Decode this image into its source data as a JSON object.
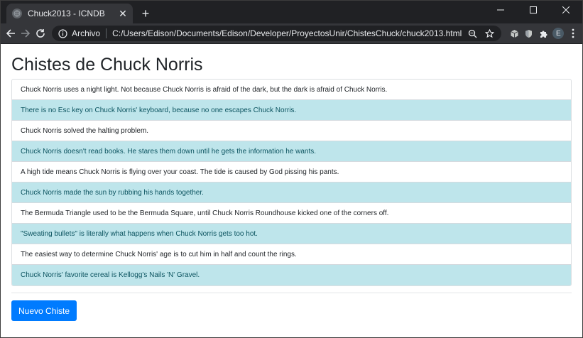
{
  "browser": {
    "tab_title": "Chuck2013 - ICNDB",
    "tab_close": "✕",
    "new_tab": "+",
    "scheme_label": "Archivo",
    "url": "C:/Users/Edison/Documents/Edison/Developer/ProyectosUnir/ChistesChuck/chuck2013.html",
    "profile_initial": "E"
  },
  "page": {
    "title": "Chistes de Chuck Norris",
    "jokes": [
      "Chuck Norris uses a night light. Not because Chuck Norris is afraid of the dark, but the dark is afraid of Chuck Norris.",
      "There is no Esc key on Chuck Norris' keyboard, because no one escapes Chuck Norris.",
      "Chuck Norris solved the halting problem.",
      "Chuck Norris doesn't read books. He stares them down until he gets the information he wants.",
      "A high tide means Chuck Norris is flying over your coast. The tide is caused by God pissing his pants.",
      "Chuck Norris made the sun by rubbing his hands together.",
      "The Bermuda Triangle used to be the Bermuda Square, until Chuck Norris Roundhouse kicked one of the corners off.",
      "\"Sweating bullets\" is literally what happens when Chuck Norris gets too hot.",
      "The easiest way to determine Chuck Norris' age is to cut him in half and count the rings.",
      "Chuck Norris' favorite cereal is Kellogg's Nails 'N' Gravel."
    ],
    "button_label": "Nuevo Chiste"
  },
  "colors": {
    "primary": "#007bff",
    "info_bg": "#bee5eb",
    "info_text": "#0c5460"
  }
}
